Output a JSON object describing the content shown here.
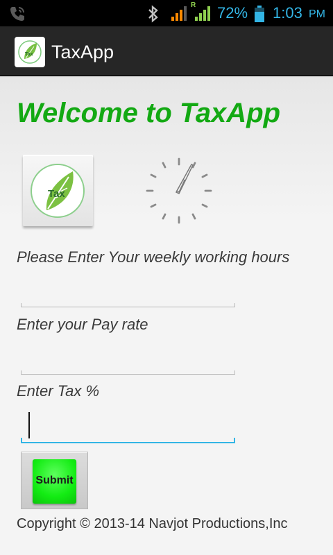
{
  "status_bar": {
    "battery_percent": "72%",
    "time": "1:03",
    "ampm": "PM",
    "roaming_label": "R",
    "icons": [
      "phone-icon",
      "bluetooth-icon",
      "signal-icon",
      "signal-roaming-icon",
      "battery-icon"
    ],
    "accent_color": "#33b5e5"
  },
  "action_bar": {
    "title": "TaxApp",
    "app_icon": "tax-leaf-icon"
  },
  "main": {
    "welcome": "Welcome to TaxApp",
    "logo_text": "Tax",
    "hours_label": "Please Enter Your weekly working hours",
    "hours_value": "",
    "pay_rate_label": "Enter your Pay rate",
    "pay_rate_value": "",
    "tax_label": "Enter Tax %",
    "tax_value": "",
    "submit_label": "Submit",
    "copyright": "Copyright © 2013-14 Navjot Productions,Inc",
    "welcome_color": "#13a913",
    "submit_color": "#13ec13"
  }
}
